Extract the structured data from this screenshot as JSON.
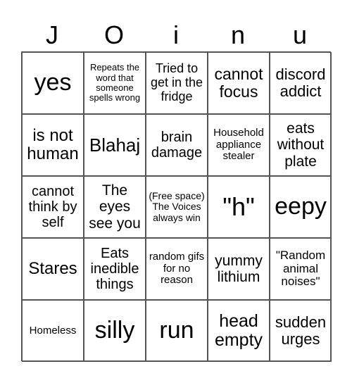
{
  "header": [
    "J",
    "O",
    "i",
    "n",
    "u"
  ],
  "cells": [
    {
      "t": "yes",
      "s": 34
    },
    {
      "t": "Repeats the word that someone spells wrong",
      "s": 13
    },
    {
      "t": "Tried to get in the fridge",
      "s": 18
    },
    {
      "t": "cannot focus",
      "s": 23
    },
    {
      "t": "discord addict",
      "s": 22
    },
    {
      "t": "is not human",
      "s": 24
    },
    {
      "t": "Blahaj",
      "s": 26
    },
    {
      "t": "brain damage",
      "s": 20
    },
    {
      "t": "Household appliance stealer",
      "s": 15
    },
    {
      "t": "eats without plate",
      "s": 21
    },
    {
      "t": "cannot think by self",
      "s": 20
    },
    {
      "t": "The eyes see you",
      "s": 21
    },
    {
      "t": "(Free space) The Voices always win",
      "s": 14
    },
    {
      "t": "\"h\"",
      "s": 36
    },
    {
      "t": "eepy",
      "s": 34
    },
    {
      "t": "Stares",
      "s": 24
    },
    {
      "t": "Eats inedible things",
      "s": 20
    },
    {
      "t": "random gifs for no reason",
      "s": 15
    },
    {
      "t": "yummy lithium",
      "s": 21
    },
    {
      "t": "\"Random animal noises\"",
      "s": 17
    },
    {
      "t": "Homeless",
      "s": 15
    },
    {
      "t": "silly",
      "s": 34
    },
    {
      "t": "run",
      "s": 34
    },
    {
      "t": "head empty",
      "s": 25
    },
    {
      "t": "sudden urges",
      "s": 22
    }
  ]
}
